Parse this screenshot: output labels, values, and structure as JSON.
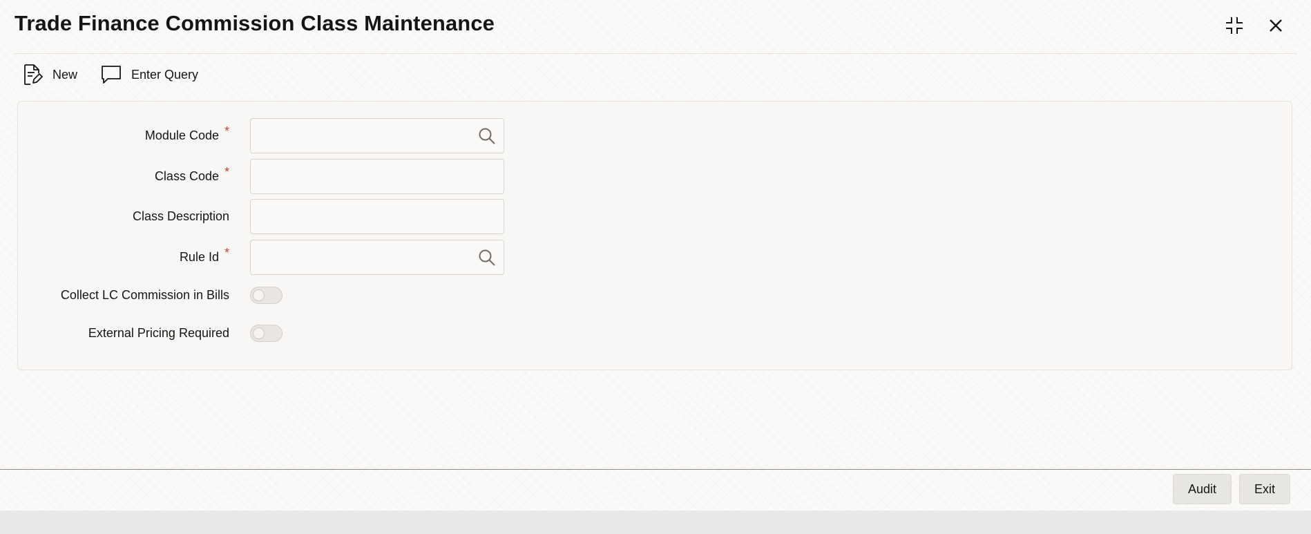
{
  "window": {
    "title": "Trade Finance Commission Class Maintenance",
    "controls": [
      "minimize-icon",
      "close-icon"
    ]
  },
  "toolbar": {
    "new_label": "New",
    "new_icon": "document-edit-icon",
    "enter_query_label": "Enter Query",
    "enter_query_icon": "speech-bubble-icon"
  },
  "form": {
    "module_code": {
      "label": "Module Code",
      "required": true,
      "value": "",
      "has_search": true
    },
    "class_code": {
      "label": "Class Code",
      "required": true,
      "value": ""
    },
    "class_description": {
      "label": "Class Description",
      "required": false,
      "value": ""
    },
    "rule_id": {
      "label": "Rule Id",
      "required": true,
      "value": "",
      "has_search": true
    },
    "collect_lc_commission": {
      "label": "Collect LC Commission in Bills",
      "checked": false
    },
    "external_pricing": {
      "label": "External Pricing Required",
      "checked": false
    },
    "required_marker": "*"
  },
  "footer": {
    "audit_label": "Audit",
    "exit_label": "Exit"
  },
  "colors": {
    "required": "#c74634",
    "text": "#161513",
    "panel": "#f8f7f5"
  }
}
